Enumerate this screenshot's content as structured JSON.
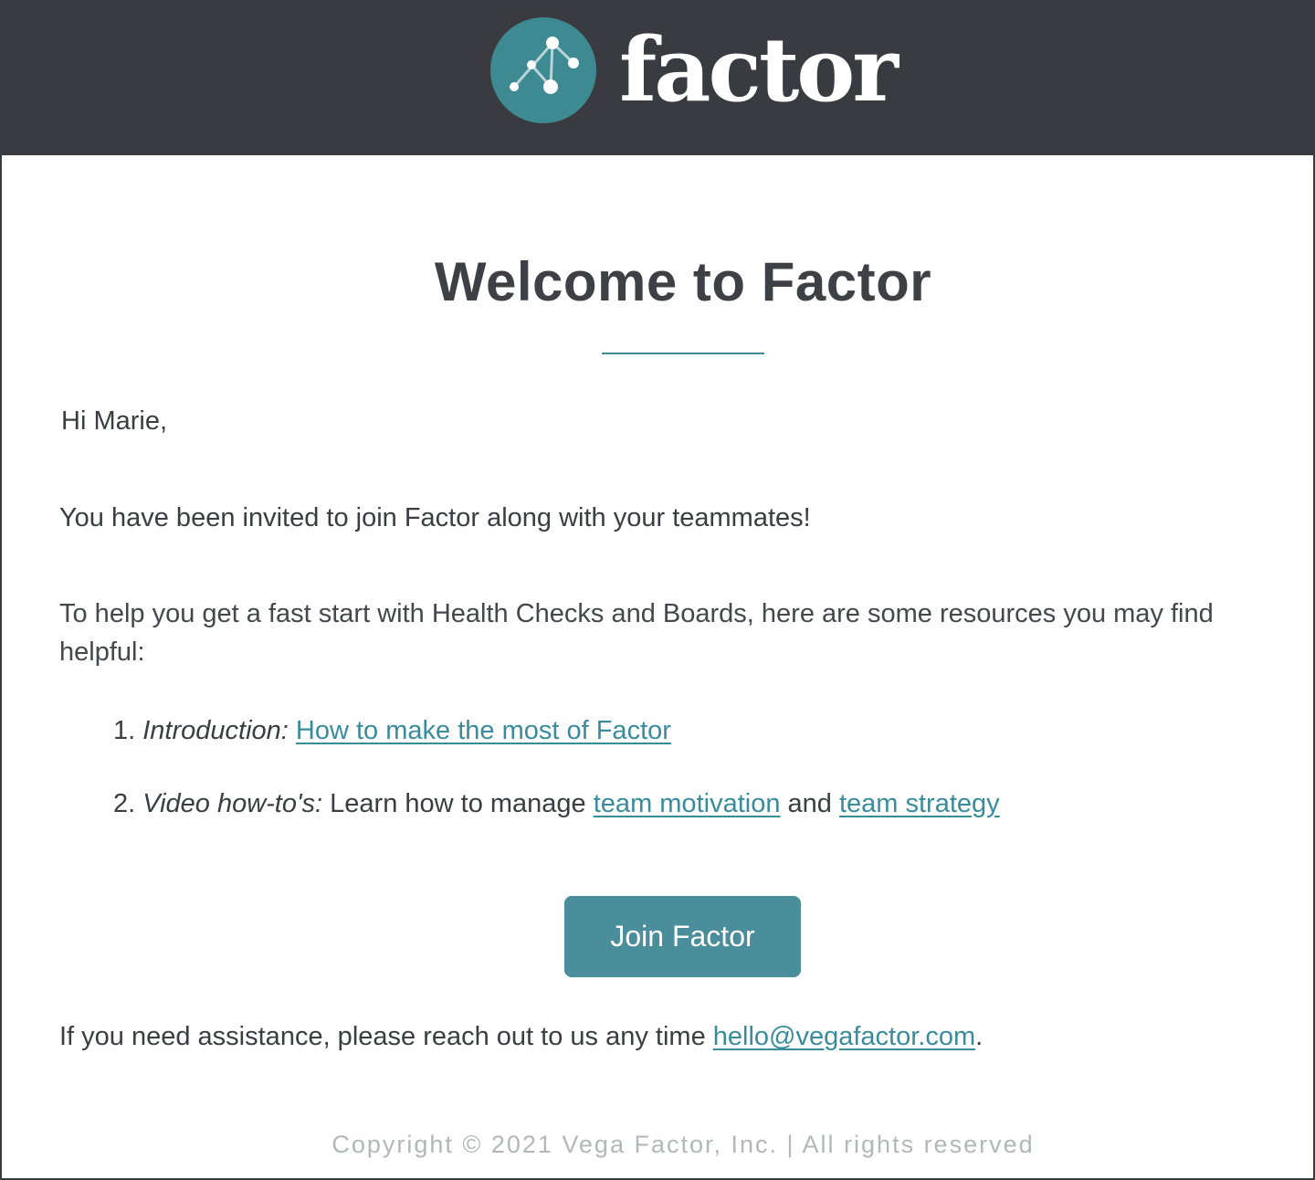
{
  "header": {
    "logo_text": "factor",
    "logo_icon": "factor-network-icon",
    "background": "#3a3b40",
    "icon_color": "#3d8a93"
  },
  "email": {
    "title": "Welcome to Factor",
    "greeting": "Hi Marie,",
    "invite_text": "You have been invited to join Factor along with your teammates!",
    "resources_intro": "To help you get a fast start with Health Checks and Boards, here are some resources you may find helpful:",
    "resources": [
      {
        "number": "1.",
        "label": "Introduction:",
        "link_text": "How to make the most of Factor"
      },
      {
        "number": "2.",
        "label": "Video how-to's:",
        "text_before": "Learn how to manage",
        "link1_text": "team motivation",
        "text_between": "and",
        "link2_text": "team strategy"
      }
    ],
    "button_label": "Join Factor",
    "assist_text": "If you need assistance, please reach out to us any time",
    "assist_email": "hello@vegafactor.com",
    "assist_end": ".",
    "footer": "Copyright © 2021 Vega Factor, Inc. | All rights reserved"
  },
  "colors": {
    "accent": "#3a8c9c",
    "button": "#4a8e9b",
    "text": "#3b3d42",
    "footer": "#b4b6ba"
  }
}
